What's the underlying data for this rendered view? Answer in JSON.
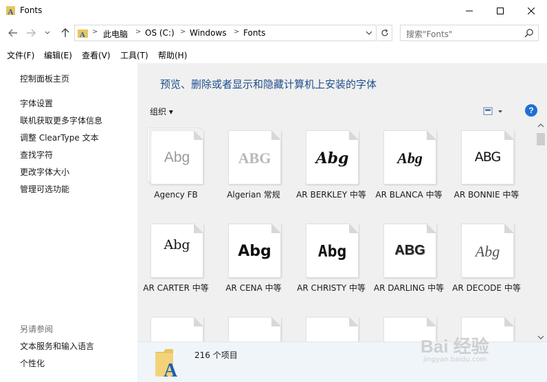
{
  "window": {
    "title": "Fonts",
    "icon": "font-folder-icon"
  },
  "nav": {
    "breadcrumbs": [
      "此电脑",
      "OS (C:)",
      "Windows",
      "Fonts"
    ],
    "search_placeholder": "搜索\"Fonts\""
  },
  "menu": [
    "文件(F)",
    "编辑(E)",
    "查看(V)",
    "工具(T)",
    "帮助(H)"
  ],
  "sidebar": {
    "home": "控制面板主页",
    "links": [
      "字体设置",
      "联机获取更多字体信息",
      "调整 ClearType 文本",
      "查找字符",
      "更改字体大小",
      "管理可选功能"
    ],
    "see_also_header": "另请参阅",
    "see_also": [
      "文本服务和输入语言",
      "个性化"
    ]
  },
  "content": {
    "heading": "预览、删除或者显示和隐藏计算机上安装的字体",
    "organize": "组织 ▾",
    "help": "?"
  },
  "fonts": [
    {
      "name": "Agency FB",
      "sample": "Abg"
    },
    {
      "name": "Algerian 常规",
      "sample": "ABG"
    },
    {
      "name": "AR BERKLEY 中等",
      "sample": "Abg"
    },
    {
      "name": "AR BLANCA 中等",
      "sample": "Abg"
    },
    {
      "name": "AR BONNIE 中等",
      "sample": "ABG"
    },
    {
      "name": "AR CARTER 中等",
      "sample": "Abg"
    },
    {
      "name": "AR CENA 中等",
      "sample": "Abg"
    },
    {
      "name": "AR CHRISTY 中等",
      "sample": "Abg"
    },
    {
      "name": "AR DARLING 中等",
      "sample": "ABG"
    },
    {
      "name": "AR DECODE 中等",
      "sample": "Abg"
    }
  ],
  "details": {
    "count": "216 个项目"
  },
  "watermark": {
    "main": "Bai 经验",
    "sub": "jingyan.baidu.com"
  },
  "colors": {
    "link": "#1e4e8c",
    "accent": "#1f6fd6",
    "pane": "#f0f0f0"
  }
}
